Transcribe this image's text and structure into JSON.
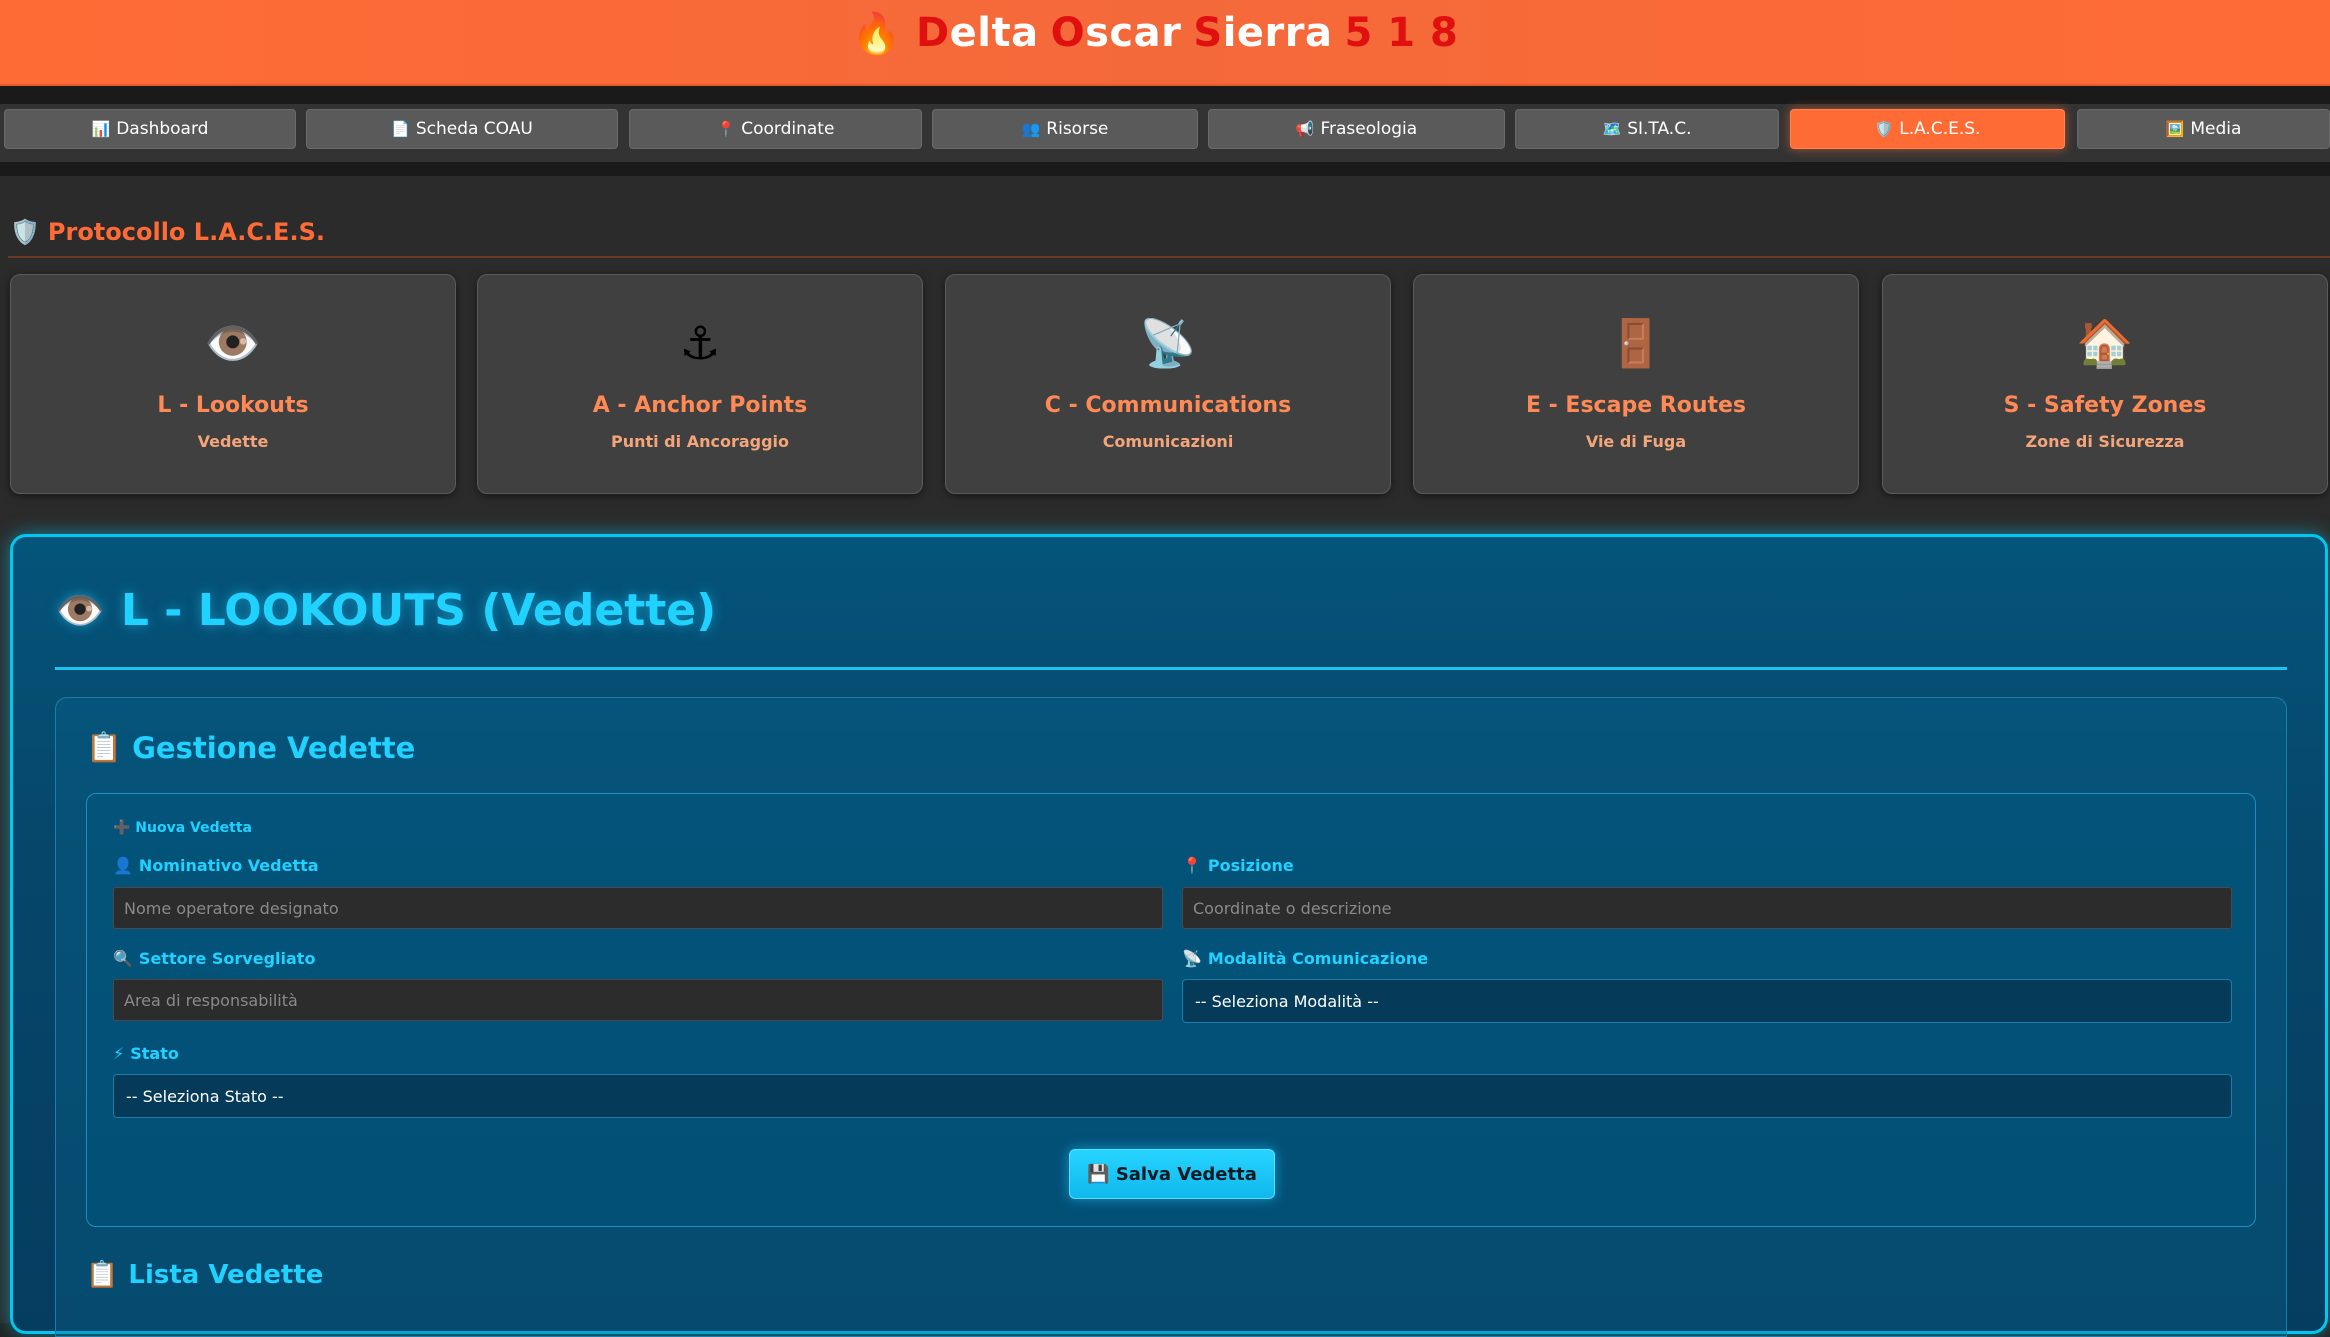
{
  "header": {
    "icon": "flame-icon",
    "title_parts": [
      "D",
      "elta",
      "O",
      "scar",
      "S",
      "ierra",
      "5 1 8"
    ]
  },
  "nav": {
    "items": [
      {
        "icon": "📊",
        "label": "Dashboard"
      },
      {
        "icon": "📄",
        "label": "Scheda COAU"
      },
      {
        "icon": "📍",
        "label": "Coordinate"
      },
      {
        "icon": "👥",
        "label": "Risorse"
      },
      {
        "icon": "📢",
        "label": "Fraseologia"
      },
      {
        "icon": "🗺️",
        "label": "SI.TA.C."
      },
      {
        "icon": "🛡️",
        "label": "L.A.C.E.S."
      },
      {
        "icon": "🖼️",
        "label": "Media"
      }
    ],
    "active": "L.A.C.E.S."
  },
  "protocol": {
    "icon": "🛡️",
    "title": "Protocollo L.A.C.E.S.",
    "cards": [
      {
        "icon": "👁️",
        "title": "L - Lookouts",
        "subtitle": "Vedette"
      },
      {
        "icon": "⚓",
        "title": "A - Anchor Points",
        "subtitle": "Punti di Ancoraggio"
      },
      {
        "icon": "📡",
        "title": "C - Communications",
        "subtitle": "Comunicazioni"
      },
      {
        "icon": "🚪",
        "title": "E - Escape Routes",
        "subtitle": "Vie di Fuga"
      },
      {
        "icon": "🏠",
        "title": "S - Safety Zones",
        "subtitle": "Zone di Sicurezza"
      }
    ]
  },
  "lookouts": {
    "icon": "👁️",
    "title": "L - LOOKOUTS (Vedette)",
    "management": {
      "icon": "📋",
      "title": "Gestione Vedette",
      "form_caption": "➕ Nuova Vedetta",
      "fields": {
        "nominativo": {
          "icon": "👤",
          "label": "Nominativo Vedetta",
          "value": "",
          "placeholder": "Nome operatore designato"
        },
        "posizione": {
          "icon": "📍",
          "label": "Posizione",
          "value": "",
          "placeholder": "Coordinate o descrizione"
        },
        "settore": {
          "icon": "🔍",
          "label": "Settore Sorvegliato",
          "value": "",
          "placeholder": "Area di responsabilità"
        },
        "modalita": {
          "icon": "📡",
          "label": "Modalità Comunicazione",
          "selected": "-- Seleziona Modalità --"
        },
        "stato": {
          "icon": "⚡",
          "label": "Stato",
          "selected": "-- Seleziona Stato --"
        }
      },
      "save_label": "💾 Salva Vedetta"
    },
    "list": {
      "icon": "📋",
      "title": "Lista Vedette"
    }
  }
}
